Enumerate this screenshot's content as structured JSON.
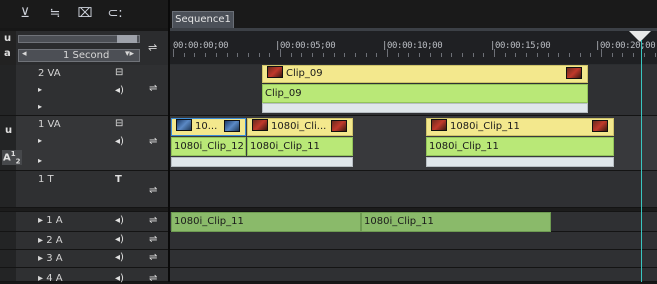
{
  "toolbar": {
    "icons": [
      "track-add-icon",
      "track-adjust-icon",
      "clip-view-icon",
      "link-icon"
    ]
  },
  "tab": {
    "label": "Sequence1"
  },
  "scale": {
    "label": "1 Second",
    "left_toggle": "u",
    "right_toggle": "a"
  },
  "ruler": {
    "labels": [
      "00:00:00;00",
      "|00:00:05;00",
      "|00:00:10;00",
      "|00:00:15;00",
      "|00:00:20;00"
    ]
  },
  "tracks": [
    {
      "id": "2va",
      "name": "2 VA"
    },
    {
      "id": "1va",
      "name": "1 VA",
      "side_a": "A",
      "side_num": "1",
      "side_num2": "2"
    },
    {
      "id": "1t",
      "name": "1 T",
      "t_icon": "T"
    },
    {
      "id": "1a",
      "name": "▸ 1 A"
    },
    {
      "id": "2a",
      "name": "▸ 2 A"
    },
    {
      "id": "3a",
      "name": "▸ 3 A"
    },
    {
      "id": "4a",
      "name": "▸ 4 A"
    }
  ],
  "clips": {
    "v2_clip09_top": "Clip_09",
    "v2_clip09_bottom": "Clip_09",
    "v1_clip_a_top": "10...",
    "v1_clip_b_top": "1080i_Cli...",
    "v1_clip_c_top": "1080i_Clip_11",
    "v1_clip_a_bottom": "1080i_Clip_12",
    "v1_clip_b_bottom": "1080i_Clip_11",
    "v1_clip_c_bottom": "1080i_Clip_11",
    "a1_clip_1": "1080i_Clip_11",
    "a1_clip_2": "1080i_Clip_11"
  },
  "colors": {
    "video_top": "#f3e88d",
    "video_bottom": "#b9e877",
    "audio": "#8aba6a",
    "playhead": "#39c6c0"
  }
}
